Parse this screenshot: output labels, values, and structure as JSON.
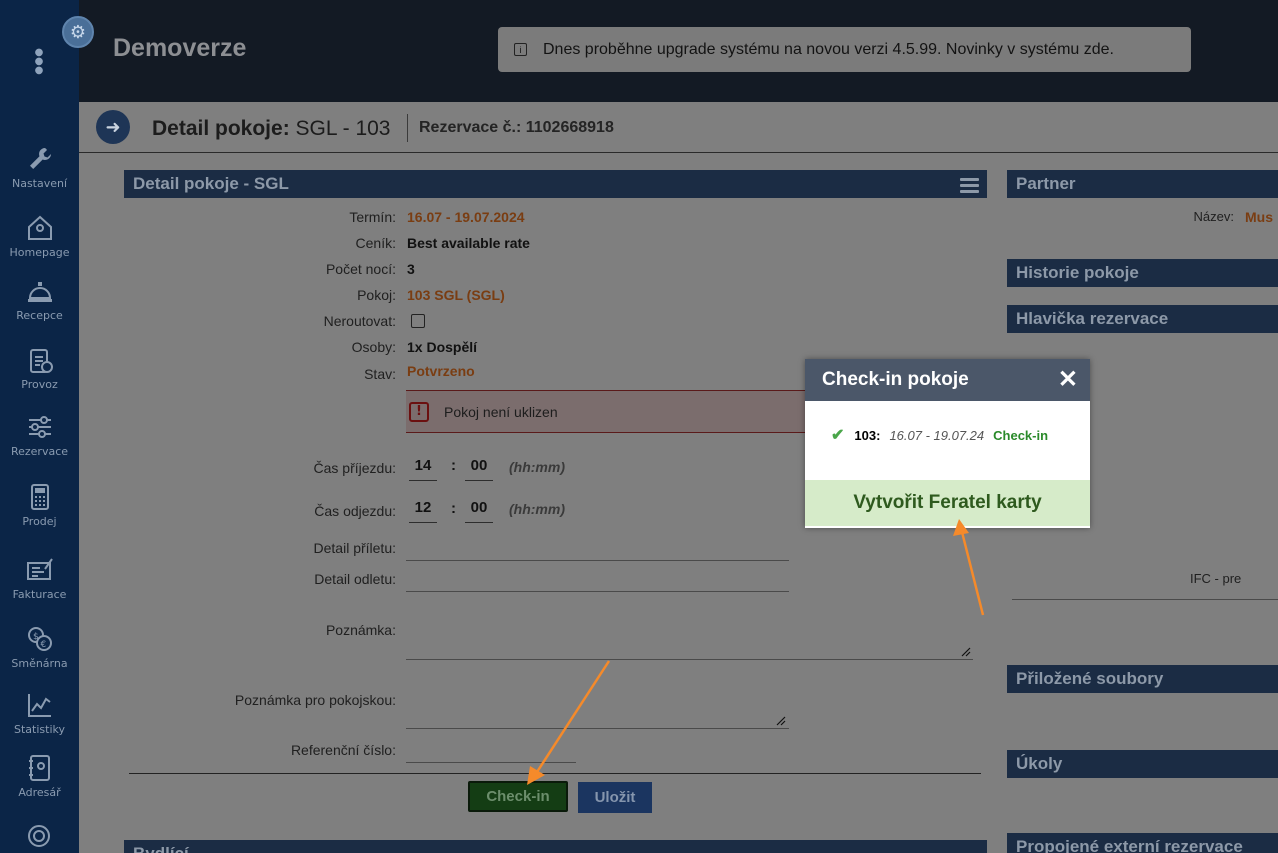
{
  "app": {
    "brand": "Demoverze"
  },
  "notice": {
    "text": "Dnes proběhne upgrade systému na novou verzi 4.5.99. Novinky v systému zde."
  },
  "sidebar": {
    "items": [
      {
        "label": "Nastavení",
        "icon": "wrench-icon"
      },
      {
        "label": "Homepage",
        "icon": "home-icon"
      },
      {
        "label": "Recepce",
        "icon": "bell-icon"
      },
      {
        "label": "Provoz",
        "icon": "clipboard-icon"
      },
      {
        "label": "Rezervace",
        "icon": "sliders-icon"
      },
      {
        "label": "Prodej",
        "icon": "calculator-icon"
      },
      {
        "label": "Fakturace",
        "icon": "invoice-icon"
      },
      {
        "label": "Směnárna",
        "icon": "exchange-icon"
      },
      {
        "label": "Statistiky",
        "icon": "chart-icon"
      },
      {
        "label": "Adresář",
        "icon": "addressbook-icon"
      }
    ]
  },
  "subheader": {
    "title_bold": "Detail pokoje:",
    "title_rest": " SGL - 103",
    "reservation": "Rezervace č.: 1102668918"
  },
  "detail": {
    "heading": "Detail pokoje - SGL",
    "fields": {
      "termin_label": "Termín:",
      "termin_value": "16.07 - 19.07.2024",
      "cenik_label": "Ceník:",
      "cenik_value": "Best available rate",
      "noci_label": "Počet nocí:",
      "noci_value": "3",
      "pokoj_label": "Pokoj:",
      "pokoj_value": "103 SGL (SGL)",
      "neroutovat_label": "Neroutovat:",
      "osoby_label": "Osoby:",
      "osoby_value": "1x Dospělí",
      "stav_label": "Stav:",
      "stav_value": "Potvrzeno"
    },
    "alert": "Pokoj není uklizen",
    "arrival_label": "Čas příjezdu:",
    "arrival_h": "14",
    "arrival_m": "00",
    "departure_label": "Čas odjezdu:",
    "departure_h": "12",
    "departure_m": "00",
    "time_hint": "(hh:mm)",
    "flight_in_label": "Detail příletu:",
    "flight_out_label": "Detail odletu:",
    "note_label": "Poznámka:",
    "maid_note_label": "Poznámka pro pokojskou:",
    "ref_label": "Referenční číslo:",
    "checkin_button": "Check-in",
    "save_button": "Uložit",
    "next_heading": "Bydlící"
  },
  "right": {
    "partner": "Partner",
    "partner_name_label": "Název:",
    "partner_name_value": "Mus",
    "history": "Historie pokoje",
    "header": "Hlavička rezervace",
    "ifc": "IFC - pre",
    "files": "Přiložené soubory",
    "tasks": "Úkoly",
    "external": "Propojené externí rezervace"
  },
  "modal": {
    "title": "Check-in pokoje",
    "room": "103:",
    "dates": "16.07 -  19.07.24",
    "status": "Check-in",
    "action": "Vytvořit Feratel karty"
  },
  "colors": {
    "sidebar": "#0b2547",
    "panel": "#1b2c44",
    "orange_arrow": "#f58a2a",
    "feratel_bg": "#d6ebc9"
  }
}
